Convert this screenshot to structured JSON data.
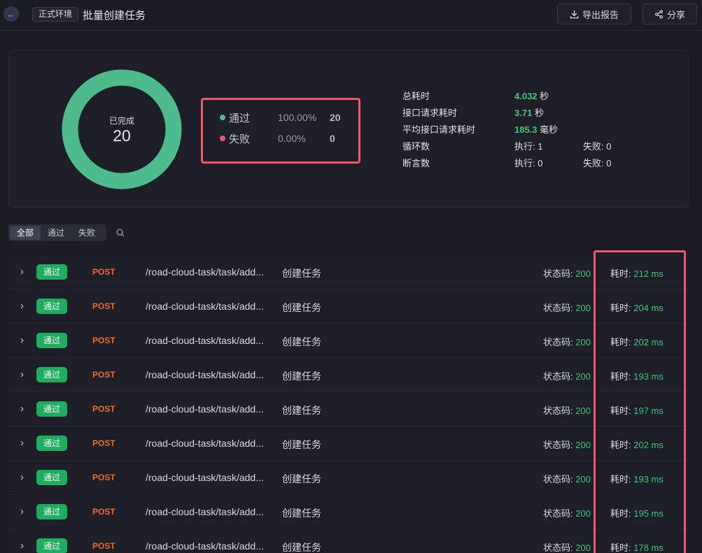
{
  "header": {
    "env_tag": "正式环境",
    "title": "批量创建任务",
    "export_label": "导出报告",
    "share_label": "分享"
  },
  "summary": {
    "donut_label": "已完成",
    "donut_value": "20",
    "legend": [
      {
        "name": "通过",
        "pct": "100.00%",
        "count": "20",
        "color": "#4dbb8c"
      },
      {
        "name": "失败",
        "pct": "0.00%",
        "count": "0",
        "color": "#f0576b"
      }
    ],
    "stats": {
      "total_time_label": "总耗时",
      "total_time_value": "4.032",
      "total_time_unit": "秒",
      "request_time_label": "接口请求耗时",
      "request_time_value": "3.71",
      "request_time_unit": "秒",
      "avg_time_label": "平均接口请求耗时",
      "avg_time_value": "185.3",
      "avg_time_unit": "毫秒",
      "loop_label": "循环数",
      "loop_exec": "执行: 1",
      "loop_fail": "失败: 0",
      "assert_label": "断言数",
      "assert_exec": "执行: 0",
      "assert_fail": "失败: 0"
    },
    "pass_ratio": 1.0,
    "donut_color": "#4dbb8c"
  },
  "filters": {
    "tabs": [
      "全部",
      "通过",
      "失败"
    ],
    "active": 0
  },
  "list": {
    "rows": [
      {
        "status": "通过",
        "method": "POST",
        "path": "/road-cloud-task/task/add...",
        "name": "创建任务",
        "code_label": "状态码: ",
        "code": "200",
        "time_label": "耗时: ",
        "time": "212 ms"
      },
      {
        "status": "通过",
        "method": "POST",
        "path": "/road-cloud-task/task/add...",
        "name": "创建任务",
        "code_label": "状态码: ",
        "code": "200",
        "time_label": "耗时: ",
        "time": "204 ms"
      },
      {
        "status": "通过",
        "method": "POST",
        "path": "/road-cloud-task/task/add...",
        "name": "创建任务",
        "code_label": "状态码: ",
        "code": "200",
        "time_label": "耗时: ",
        "time": "202 ms"
      },
      {
        "status": "通过",
        "method": "POST",
        "path": "/road-cloud-task/task/add...",
        "name": "创建任务",
        "code_label": "状态码: ",
        "code": "200",
        "time_label": "耗时: ",
        "time": "193 ms"
      },
      {
        "status": "通过",
        "method": "POST",
        "path": "/road-cloud-task/task/add...",
        "name": "创建任务",
        "code_label": "状态码: ",
        "code": "200",
        "time_label": "耗时: ",
        "time": "197 ms"
      },
      {
        "status": "通过",
        "method": "POST",
        "path": "/road-cloud-task/task/add...",
        "name": "创建任务",
        "code_label": "状态码: ",
        "code": "200",
        "time_label": "耗时: ",
        "time": "202 ms"
      },
      {
        "status": "通过",
        "method": "POST",
        "path": "/road-cloud-task/task/add...",
        "name": "创建任务",
        "code_label": "状态码: ",
        "code": "200",
        "time_label": "耗时: ",
        "time": "193 ms"
      },
      {
        "status": "通过",
        "method": "POST",
        "path": "/road-cloud-task/task/add...",
        "name": "创建任务",
        "code_label": "状态码: ",
        "code": "200",
        "time_label": "耗时: ",
        "time": "195 ms"
      },
      {
        "status": "通过",
        "method": "POST",
        "path": "/road-cloud-task/task/add...",
        "name": "创建任务",
        "code_label": "状态码: ",
        "code": "200",
        "time_label": "耗时: ",
        "time": "178 ms"
      }
    ]
  }
}
